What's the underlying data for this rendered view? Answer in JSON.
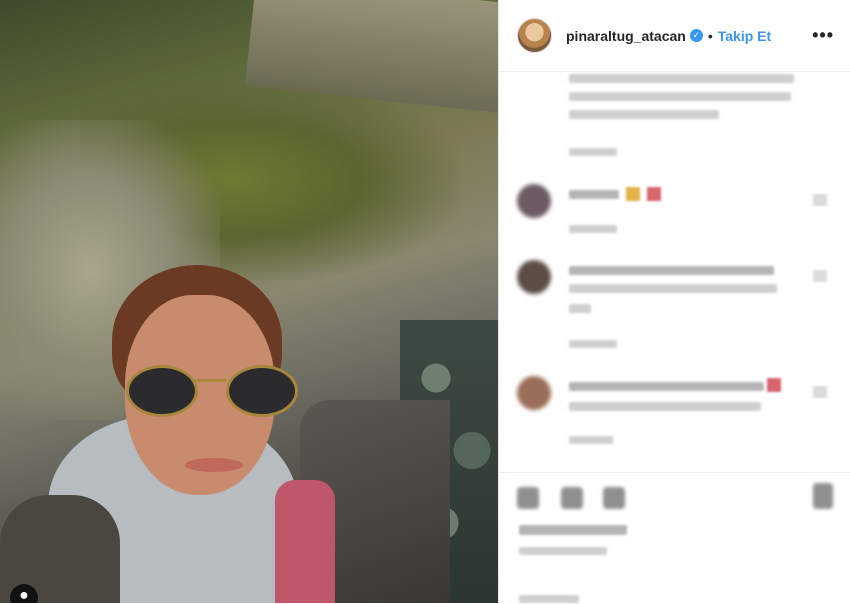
{
  "post": {
    "username": "pinaraltug_atacan",
    "separator": "•",
    "follow_label": "Takip Et",
    "more_icon": "more-options-icon",
    "verified_glyph": "✓",
    "more_glyph": "•••"
  },
  "photo": {
    "user_tag_glyph": "●"
  },
  "colors": {
    "accent": "#3897f0",
    "text": "#262626"
  }
}
